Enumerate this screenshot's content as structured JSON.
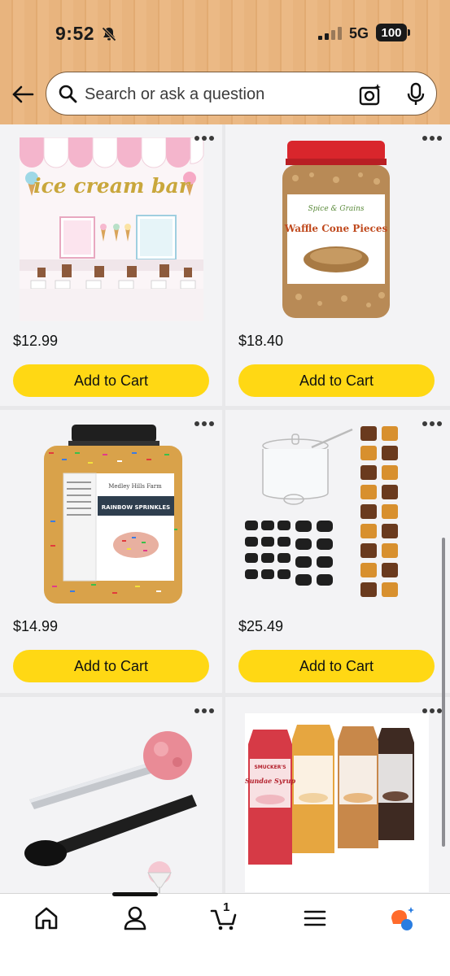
{
  "status_bar": {
    "time": "9:52",
    "network": "5G",
    "battery": "100"
  },
  "search": {
    "placeholder": "Search or ask a question"
  },
  "products": [
    {
      "name": "Ice cream bar party decoration set",
      "image_label": "ice cream bar",
      "price": "$12.99",
      "button": "Add to Cart"
    },
    {
      "name": "Waffle Cone Pieces jar",
      "image_label": "Waffle Cone Pieces",
      "image_brand": "Spice & Grains",
      "price": "$18.40",
      "button": "Add to Cart"
    },
    {
      "name": "Rainbow Sprinkles jar",
      "image_label": "RAINBOW SPRINKLES",
      "image_brand": "Medley Hills Farm",
      "price": "$14.99",
      "button": "Add to Cart"
    },
    {
      "name": "Glass condiment jar with spoon and chalkboard labels",
      "price": "$25.49",
      "button": "Add to Cart"
    },
    {
      "name": "Ice cream scoops",
      "price": "",
      "button": ""
    },
    {
      "name": "Smucker's Sundae Syrup bottles",
      "image_label": "Sundae Syrup",
      "image_brand": "SMUCKER'S",
      "price": "",
      "button": ""
    }
  ],
  "bottom_nav": {
    "cart_count": "1",
    "items": [
      "home-icon",
      "account-icon",
      "cart-icon",
      "menu-icon",
      "rufus-icon"
    ]
  },
  "colors": {
    "header_bg": "#e8b47e",
    "add_to_cart": "#ffd814",
    "card_bg": "#f3f3f5"
  }
}
